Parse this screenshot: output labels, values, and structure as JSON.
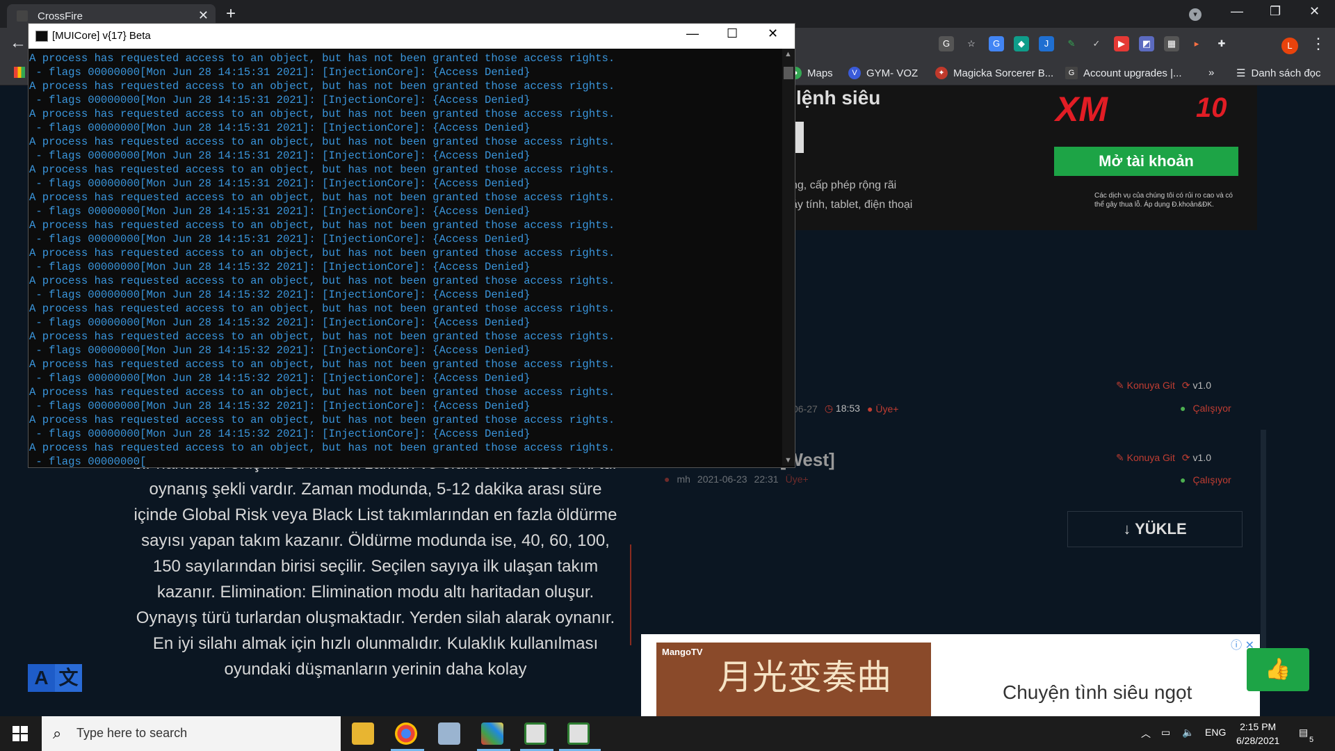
{
  "browser": {
    "tab_title": "CrossFire",
    "tab_close": "✕",
    "new_tab": "+",
    "back": "←",
    "tab_search": "▾",
    "win_minimize": "—",
    "win_maximize": "❐",
    "win_close": "✕",
    "menu": "⋮",
    "profile_letter": "L",
    "bookmarks": [
      {
        "label": "Maps",
        "color": "#34a853"
      },
      {
        "label": "GYM- VOZ",
        "color": "#3a5bd9"
      },
      {
        "label": "Magicka Sorcerer B...",
        "color": "#c0392b"
      },
      {
        "label": "Account upgrades |...",
        "color": "#444444"
      }
    ],
    "bookmarks_more": "»",
    "reading_list": "Danh sách đọc"
  },
  "page": {
    "ad": {
      "headline": "lệnh siêu",
      "text1": "ng, cấp phép rộng rãi",
      "text2": "áy tính, tablet, điện thoại",
      "brand": "XM",
      "years": "10",
      "cta": "Mở tài khoản",
      "disclaimer": "Các dịch vụ của chúng tôi có rủi ro cao và có thể gây thua lỗ. Áp dụng Đ.khoản&ĐK."
    },
    "files": [
      {
        "konuya": "Konuya Git",
        "version": "v1.0",
        "date": "06-27",
        "time": "18:53",
        "badge": "Üye+",
        "status": "Çalışıyor"
      },
      {
        "konuya": "Konuya Git",
        "version": "v1.0",
        "author": "mh",
        "date": "2021-06-23",
        "time": "22:31",
        "badge": "Üye+",
        "status": "Çalışıyor",
        "title": "k [West]"
      }
    ],
    "upload": "YÜKLE",
    "article": "bir haritadan oluşur. Bu modda zaman ve ölüm olmak üzere iki tür oynanış şekli vardır. Zaman modunda, 5-12 dakika arası süre içinde Global Risk veya Black List takımlarından en fazla öldürme sayısı yapan takım kazanır. Öldürme modunda ise, 40, 60, 100, 150 sayılarından birisi seçilir. Seçilen sayıya ilk ulaşan takım kazanır. Elimination: Elimination modu altı haritadan oluşur. Oynayış türü turlardan oluşmaktadır. Yerden silah alarak oynanır. En iyi silahı almak için hızlı olunmalıdır. Kulaklık kullanılması oyundaki düşmanların yerinin daha kolay",
    "bottom_ad": {
      "brand": "MangoTV",
      "poster_title": "月光变奏曲",
      "caption": "Chuyện tình siêu ngọt",
      "close": "ⓘ ✕"
    }
  },
  "console": {
    "title": "[MUICore] v{17} Beta",
    "minimize": "—",
    "maximize": "☐",
    "close": "✕",
    "lines": [
      "A process has requested access to an object, but has not been granted those access rights.",
      " - flags 00000000[Mon Jun 28 14:15:31 2021]: [InjectionCore]: {Access Denied}",
      "A process has requested access to an object, but has not been granted those access rights.",
      " - flags 00000000[Mon Jun 28 14:15:31 2021]: [InjectionCore]: {Access Denied}",
      "A process has requested access to an object, but has not been granted those access rights.",
      " - flags 00000000[Mon Jun 28 14:15:31 2021]: [InjectionCore]: {Access Denied}",
      "A process has requested access to an object, but has not been granted those access rights.",
      " - flags 00000000[Mon Jun 28 14:15:31 2021]: [InjectionCore]: {Access Denied}",
      "A process has requested access to an object, but has not been granted those access rights.",
      " - flags 00000000[Mon Jun 28 14:15:31 2021]: [InjectionCore]: {Access Denied}",
      "A process has requested access to an object, but has not been granted those access rights.",
      " - flags 00000000[Mon Jun 28 14:15:31 2021]: [InjectionCore]: {Access Denied}",
      "A process has requested access to an object, but has not been granted those access rights.",
      " - flags 00000000[Mon Jun 28 14:15:31 2021]: [InjectionCore]: {Access Denied}",
      "A process has requested access to an object, but has not been granted those access rights.",
      " - flags 00000000[Mon Jun 28 14:15:32 2021]: [InjectionCore]: {Access Denied}",
      "A process has requested access to an object, but has not been granted those access rights.",
      " - flags 00000000[Mon Jun 28 14:15:32 2021]: [InjectionCore]: {Access Denied}",
      "A process has requested access to an object, but has not been granted those access rights.",
      " - flags 00000000[Mon Jun 28 14:15:32 2021]: [InjectionCore]: {Access Denied}",
      "A process has requested access to an object, but has not been granted those access rights.",
      " - flags 00000000[Mon Jun 28 14:15:32 2021]: [InjectionCore]: {Access Denied}",
      "A process has requested access to an object, but has not been granted those access rights.",
      " - flags 00000000[Mon Jun 28 14:15:32 2021]: [InjectionCore]: {Access Denied}",
      "A process has requested access to an object, but has not been granted those access rights.",
      " - flags 00000000[Mon Jun 28 14:15:32 2021]: [InjectionCore]: {Access Denied}",
      "A process has requested access to an object, but has not been granted those access rights.",
      " - flags 00000000[Mon Jun 28 14:15:32 2021]: [InjectionCore]: {Access Denied}",
      "A process has requested access to an object, but has not been granted those access rights.",
      " - flags 00000000["
    ]
  },
  "taskbar": {
    "search_placeholder": "Type here to search",
    "language": "ENG",
    "time": "2:15 PM",
    "date": "6/28/2021",
    "notifications": "5"
  },
  "colors": {
    "console_text": "#3a96dd",
    "cta_green": "#1da446",
    "brand_red": "#e21d25"
  }
}
